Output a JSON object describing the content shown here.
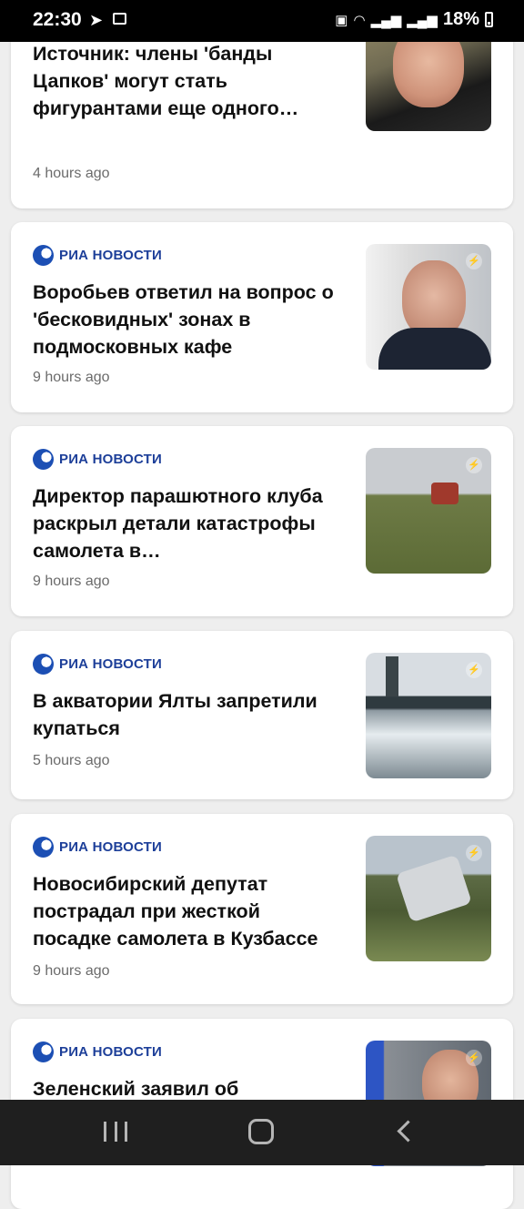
{
  "status_bar": {
    "time": "22:30",
    "battery": "18%",
    "icons": [
      "telegram-icon",
      "image-icon",
      "battery-saver-icon",
      "wifi-icon",
      "signal-icon",
      "signal-icon"
    ]
  },
  "feed": {
    "source_name": "РИА НОВОСТИ",
    "items": [
      {
        "title": "Источник: члены 'банды Цапков' могут стать фигурантами еще одного…",
        "time": "4 hours ago"
      },
      {
        "title": "Воробьев ответил на вопрос о 'бесковидных' зонах в подмосковных кафе",
        "time": "9 hours ago"
      },
      {
        "title": "Директор парашютного клуба раскрыл детали катастрофы самолета в…",
        "time": "9 hours ago"
      },
      {
        "title": "В акватории Ялты запретили купаться",
        "time": "5 hours ago"
      },
      {
        "title": "Новосибирский депутат пострадал при жесткой посадке самолета в Кузбассе",
        "time": "9 hours ago"
      },
      {
        "title": "Зеленский заявил об",
        "time": ""
      }
    ]
  },
  "nav_bar": {
    "icons": [
      "recent-apps-icon",
      "home-icon",
      "back-icon"
    ]
  }
}
